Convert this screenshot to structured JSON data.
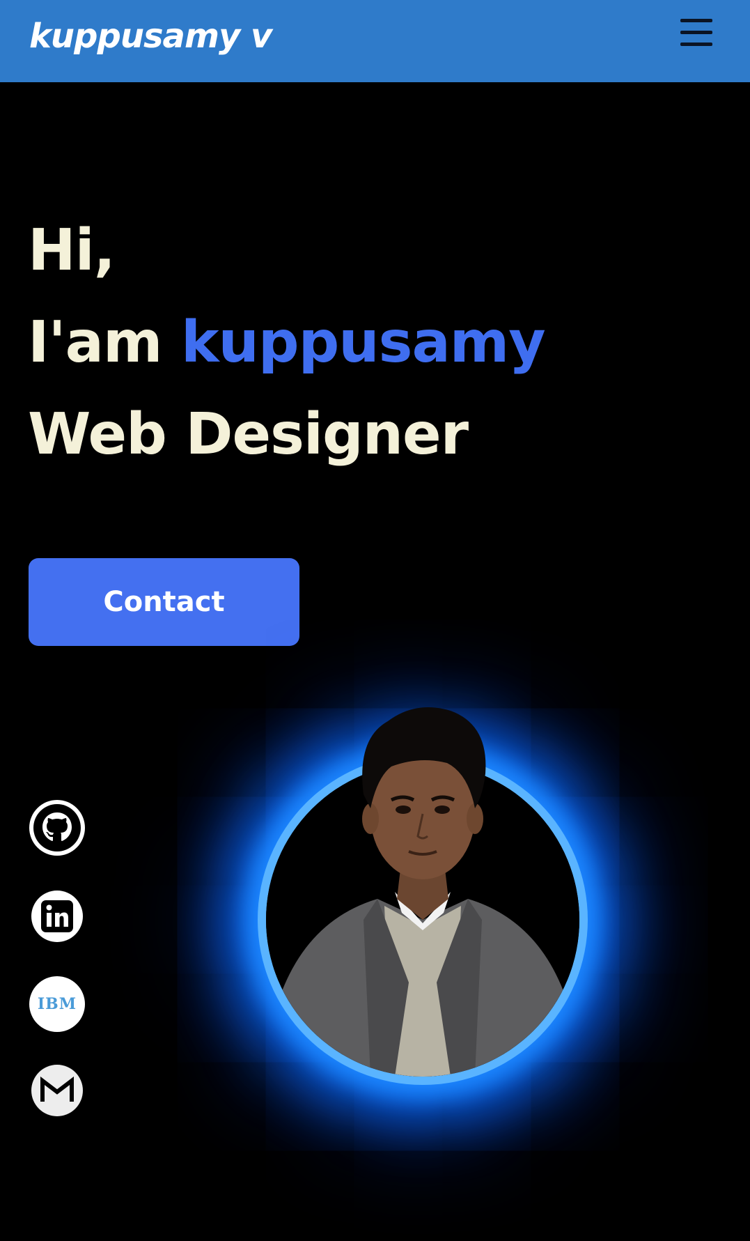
{
  "navbar": {
    "brand": "kuppusamy v",
    "menu_icon": "hamburger-menu-icon",
    "background_color": "#2f7bca"
  },
  "hero": {
    "greeting": "Hi,",
    "intro_prefix": "I'am",
    "name": "kuppusamy",
    "role": "Web Designer",
    "text_color": "#f4f1d9",
    "accent_color": "#3f6ef0"
  },
  "contact_button": {
    "label": "Contact",
    "color": "#4470f0"
  },
  "social_links": [
    {
      "icon": "github-icon"
    },
    {
      "icon": "linkedin-icon"
    },
    {
      "icon": "ibm-icon",
      "text": "IBM"
    },
    {
      "icon": "gmail-icon"
    }
  ],
  "profile": {
    "image": "profile-photo",
    "glow_color": "#1c86ff"
  }
}
